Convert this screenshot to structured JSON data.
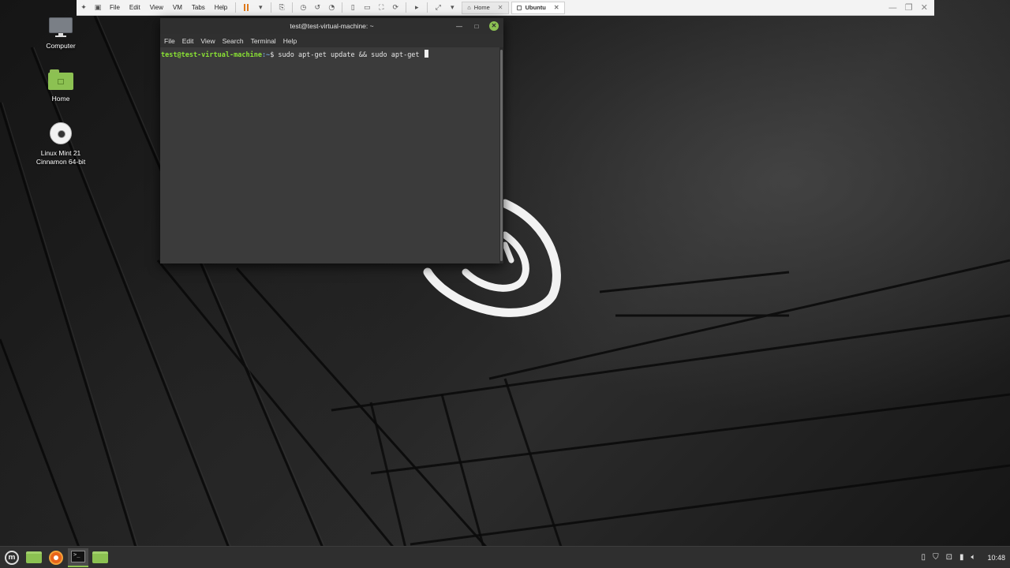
{
  "vm_toolbar": {
    "menu": [
      "File",
      "Edit",
      "View",
      "VM",
      "Tabs",
      "Help"
    ],
    "tabs": [
      {
        "label": "Home",
        "active": false
      },
      {
        "label": "Ubuntu",
        "active": true
      }
    ]
  },
  "desktop_icons": [
    {
      "label": "Computer",
      "icon": "computer-icon"
    },
    {
      "label": "Home",
      "icon": "home-folder-icon"
    },
    {
      "label": "Linux Mint 21 Cinnamon 64-bit",
      "icon": "disc-icon"
    }
  ],
  "terminal": {
    "title": "test@test-virtual-machine: ~",
    "menu": [
      "File",
      "Edit",
      "View",
      "Search",
      "Terminal",
      "Help"
    ],
    "prompt_user": "test@test-virtual-machine",
    "prompt_path": ":~",
    "prompt_symbol": "$",
    "command": " sudo apt-get update && sudo apt-get "
  },
  "taskbar": {
    "launchers": [
      "mint-menu-icon",
      "files-icon",
      "firefox-icon",
      "terminal-icon",
      "files-icon"
    ],
    "tray_icons": [
      "clipboard-icon",
      "shield-icon",
      "network-icon",
      "battery-icon",
      "volume-icon"
    ],
    "clock": "10:48"
  },
  "colors": {
    "mint_green": "#8cc152",
    "prompt_green": "#8ae234",
    "prompt_blue": "#729fcf",
    "vm_pause_orange": "#e07a1c"
  }
}
